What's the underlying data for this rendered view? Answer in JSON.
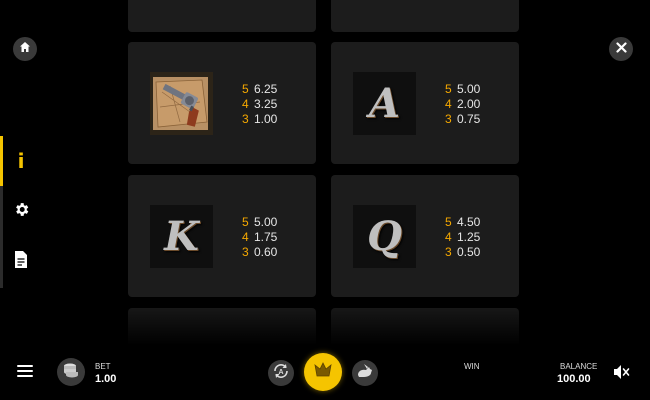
{
  "nav": {
    "home_icon": "home-icon",
    "close_icon": "close-icon"
  },
  "side_menu": [
    {
      "icon": "info-icon",
      "label": "i",
      "active": true
    },
    {
      "icon": "gear-icon",
      "active": false
    },
    {
      "icon": "document-icon",
      "active": false
    }
  ],
  "paytable": [
    {
      "symbol": "revolver",
      "pays": [
        {
          "count": "5",
          "value": "6.25"
        },
        {
          "count": "4",
          "value": "3.25"
        },
        {
          "count": "3",
          "value": "1.00"
        }
      ]
    },
    {
      "symbol": "A",
      "pays": [
        {
          "count": "5",
          "value": "5.00"
        },
        {
          "count": "4",
          "value": "2.00"
        },
        {
          "count": "3",
          "value": "0.75"
        }
      ]
    },
    {
      "symbol": "K",
      "pays": [
        {
          "count": "5",
          "value": "5.00"
        },
        {
          "count": "4",
          "value": "1.75"
        },
        {
          "count": "3",
          "value": "0.60"
        }
      ]
    },
    {
      "symbol": "Q",
      "pays": [
        {
          "count": "5",
          "value": "4.50"
        },
        {
          "count": "4",
          "value": "1.25"
        },
        {
          "count": "3",
          "value": "0.50"
        }
      ]
    }
  ],
  "bottom_bar": {
    "bet_label": "BET",
    "bet_value": "1.00",
    "win_label": "WIN",
    "balance_label": "BALANCE",
    "balance_value": "100.00",
    "colors": {
      "spin": "#f5c400",
      "accent": "#f5a800"
    }
  }
}
